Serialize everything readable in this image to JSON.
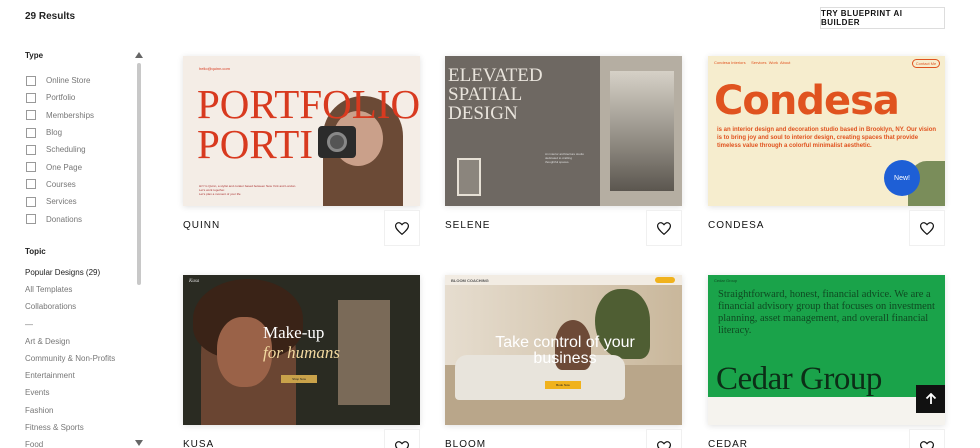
{
  "header": {
    "results_count": "29 Results",
    "blueprint_label": "TRY BLUEPRINT AI BUILDER"
  },
  "sidebar": {
    "type_heading": "Type",
    "type_filters": [
      "Online Store",
      "Portfolio",
      "Memberships",
      "Blog",
      "Scheduling",
      "One Page",
      "Courses",
      "Services",
      "Donations"
    ],
    "topic_heading": "Topic",
    "topics": [
      "Popular Designs (29)",
      "All Templates",
      "Collaborations",
      "—",
      "Art & Design",
      "Community & Non-Profits",
      "Entertainment",
      "Events",
      "Fashion",
      "Fitness & Sports",
      "Food"
    ]
  },
  "templates": [
    {
      "name": "QUINN",
      "preview_headline": "PORTFOLIO PORTI",
      "preview_small": "hello@quinn.com",
      "preview_body": "Hi! I'm Quinn, a stylist and curator based between New York and London. Let's work together.",
      "preview_body2": "Let's plan a moment of your life"
    },
    {
      "name": "SELENE",
      "preview_headline": "ELEVATED SPATIAL DESIGN",
      "preview_body": "An interior architecture studio dedicated to crafting thoughtful spaces."
    },
    {
      "name": "CONDESA",
      "preview_headline": "Condesa",
      "preview_nav": "Condesa Interiors     Services  Work  About",
      "preview_contact": "Contact Me",
      "preview_body": "is an interior design and decoration studio based in Brooklyn, NY. Our vision is to bring joy and soul to interior design, creating spaces that provide timeless value through a colorful minimalist aesthetic.",
      "preview_badge": "New!"
    },
    {
      "name": "KUSA",
      "preview_logo": "Kusa",
      "preview_headline": "Make-up",
      "preview_headline2": "for humans",
      "preview_cta": "Shop Now"
    },
    {
      "name": "BLOOM",
      "preview_logo": "BLOOM COACHING",
      "preview_headline": "Take control of your business",
      "preview_cta": "Book Now"
    },
    {
      "name": "CEDAR",
      "preview_logo": "Cedar Group",
      "preview_body": "Straightforward, honest, financial advice. We are a financial advisory group that focuses on investment planning, asset management, and overall financial literacy.",
      "preview_headline": "Cedar Group"
    }
  ],
  "colors": {
    "quinn_accent": "#d83a1f",
    "condesa_accent": "#e0531f",
    "condesa_badge": "#1e5fd6",
    "cedar_green": "#1aa34a",
    "bloom_yellow": "#f0b21d"
  },
  "icons": {
    "favorite": "heart-icon",
    "scroll_top": "arrow-up-icon"
  }
}
